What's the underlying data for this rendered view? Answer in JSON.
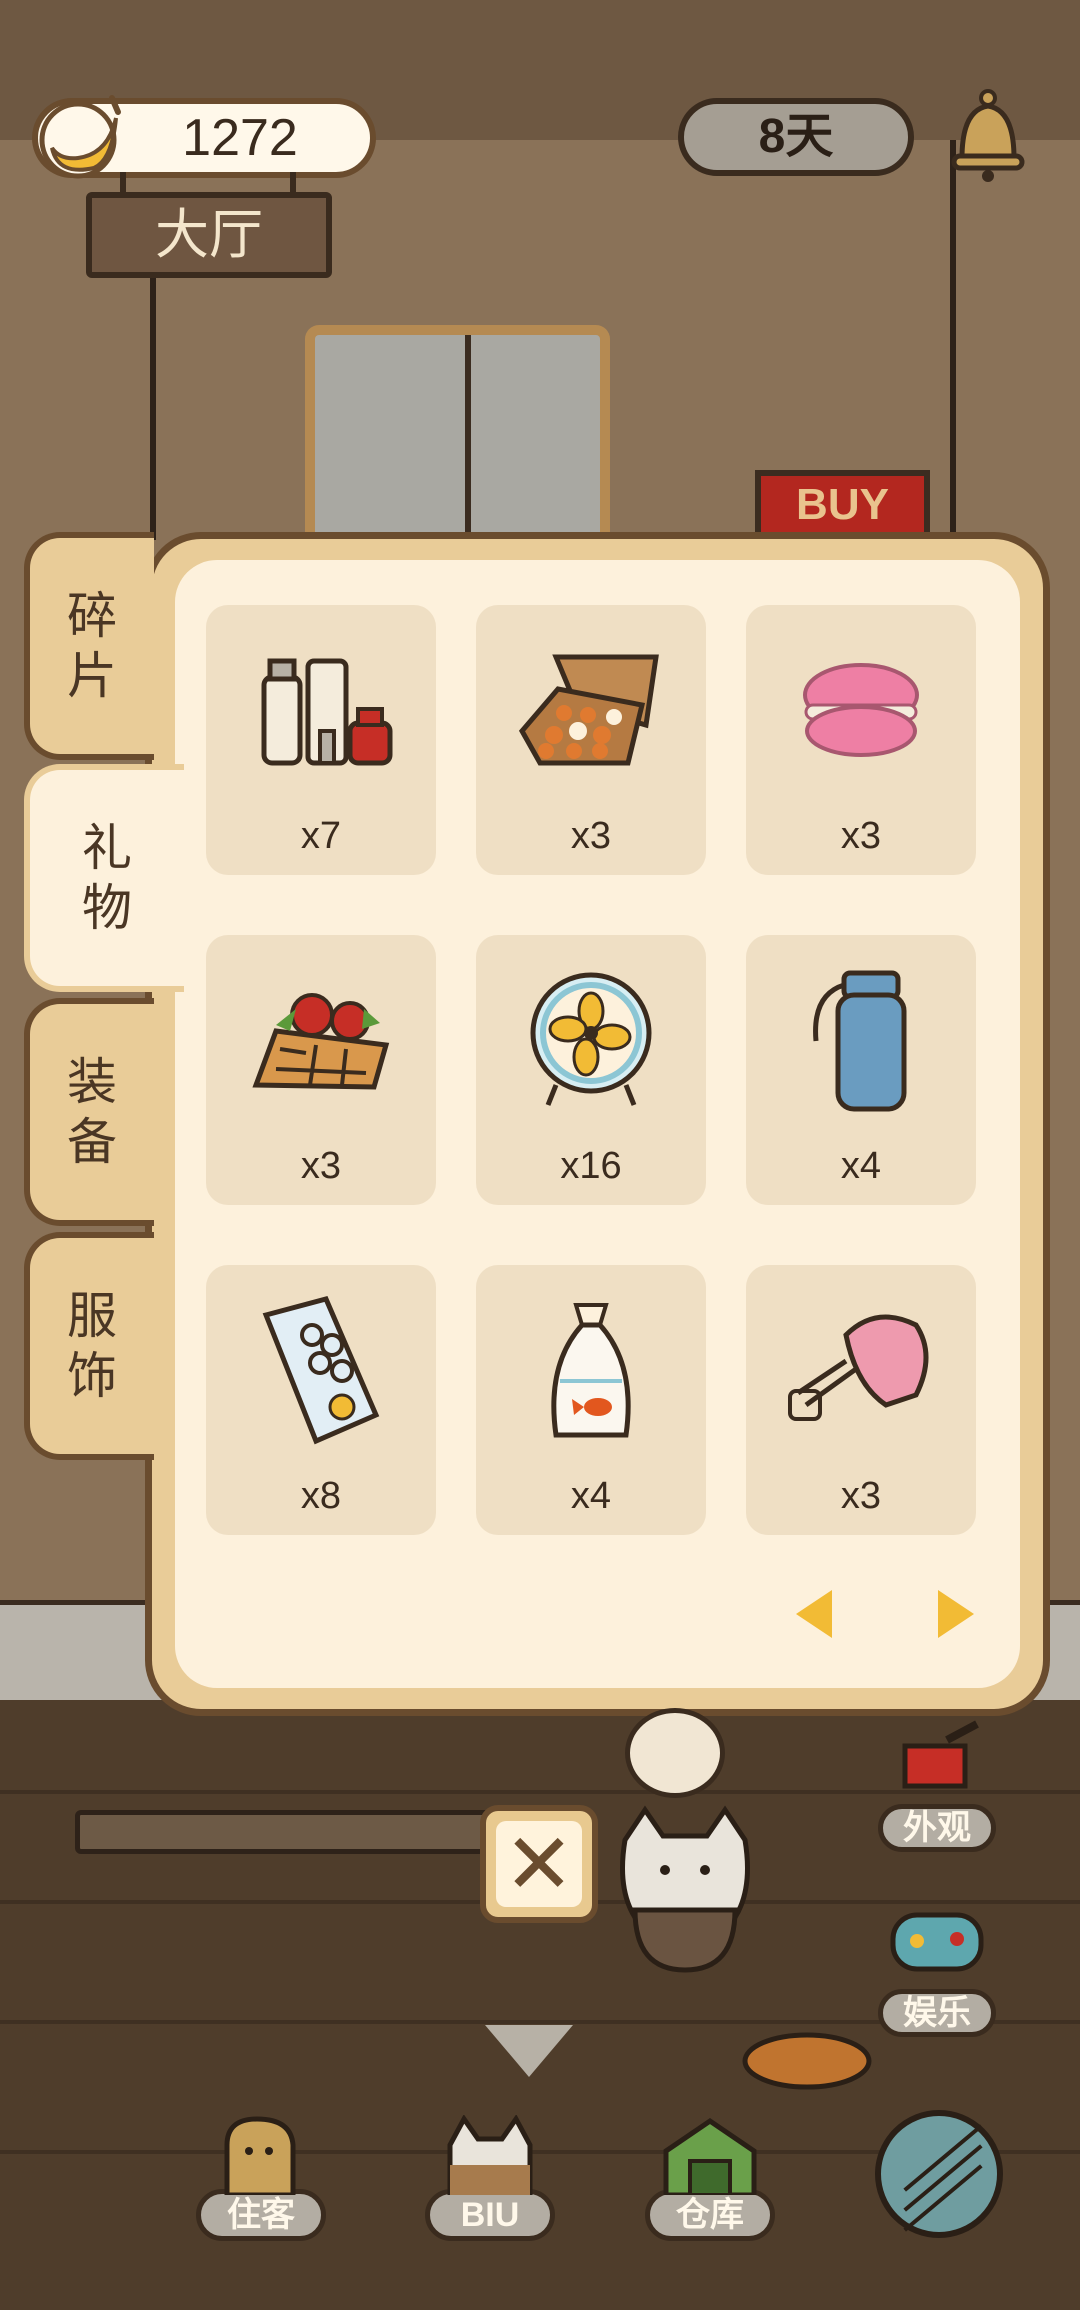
{
  "hud": {
    "coins": "1272",
    "room": "大厅",
    "days": "8天"
  },
  "background": {
    "shop_sign": "BUY"
  },
  "inventory": {
    "tabs": [
      {
        "label": "碎片",
        "active": false
      },
      {
        "label": "礼物",
        "active": true
      },
      {
        "label": "装备",
        "active": false
      },
      {
        "label": "服饰",
        "active": false
      }
    ],
    "items": [
      {
        "icon": "skincare-set-icon",
        "qty": "x7"
      },
      {
        "icon": "chocolate-box-icon",
        "qty": "x3"
      },
      {
        "icon": "macaron-icon",
        "qty": "x3"
      },
      {
        "icon": "strawberry-waffle-icon",
        "qty": "x3"
      },
      {
        "icon": "desk-fan-icon",
        "qty": "x16"
      },
      {
        "icon": "water-bottle-icon",
        "qty": "x4"
      },
      {
        "icon": "milk-carton-icon",
        "qty": "x8"
      },
      {
        "icon": "goldfish-bag-icon",
        "qty": "x4"
      },
      {
        "icon": "hand-mixer-icon",
        "qty": "x3"
      }
    ]
  },
  "side_buttons": {
    "appearance": "外观",
    "entertainment": "娱乐"
  },
  "bottom_nav": {
    "guests": "住客",
    "biu": "BIU",
    "warehouse": "仓库"
  },
  "colors": {
    "panel_border": "#6a4c2e",
    "panel_frame": "#e9cc98",
    "panel_bg": "#fdf1dc",
    "cell_bg": "#efdfc4",
    "arrow": "#f2bb35"
  }
}
